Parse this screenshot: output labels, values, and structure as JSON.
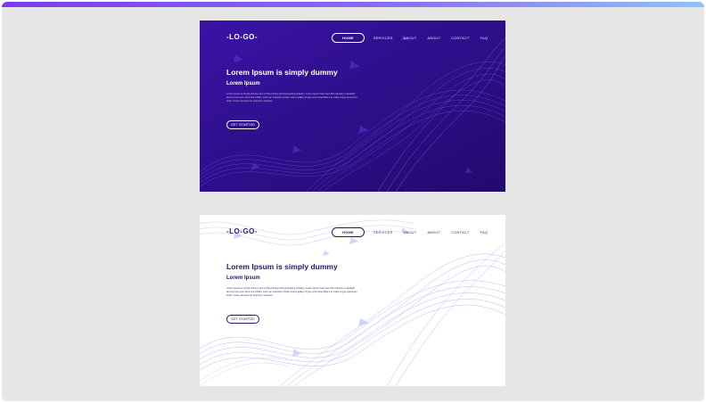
{
  "colors": {
    "top_bar_start": "#7a3cf0",
    "top_bar_end": "#8ec4f5",
    "dark_background": "#2d0f8a",
    "light_accent": "#2b1272"
  },
  "dark_card": {
    "logo": "-LO-GO-",
    "nav": [
      "HOME",
      "SERVICES",
      "ABOUT",
      "ABOUT",
      "CONTACT",
      "FAQ"
    ],
    "title": "Lorem Ipsum is simply dummy",
    "subtitle": "Lorem Ipsum",
    "body": "Lorem Ipsum is simply dummy text of the printing and typesetting industry. Lorem Ipsum has been the industry's standard dummy text ever since the 1500s, when an unknown printer took a galley of type and scrambled it to make a type specimen book. It has survived not only five centuries.",
    "cta": "GET STARTED"
  },
  "light_card": {
    "logo": "-LO-GO-",
    "nav": [
      "HOME",
      "SERVICES",
      "ABOUT",
      "ABOUT",
      "CONTACT",
      "FAQ"
    ],
    "title": "Lorem Ipsum is simply dummy",
    "subtitle": "Lorem Ipsum",
    "body": "Lorem Ipsum is simply dummy text of the printing and typesetting industry. Lorem Ipsum has been the industry's standard dummy text ever since the 1500s, when an unknown printer took a galley of type and scrambled it to make a type specimen book. It has survived not only five centuries.",
    "cta": "GET STARTED"
  }
}
